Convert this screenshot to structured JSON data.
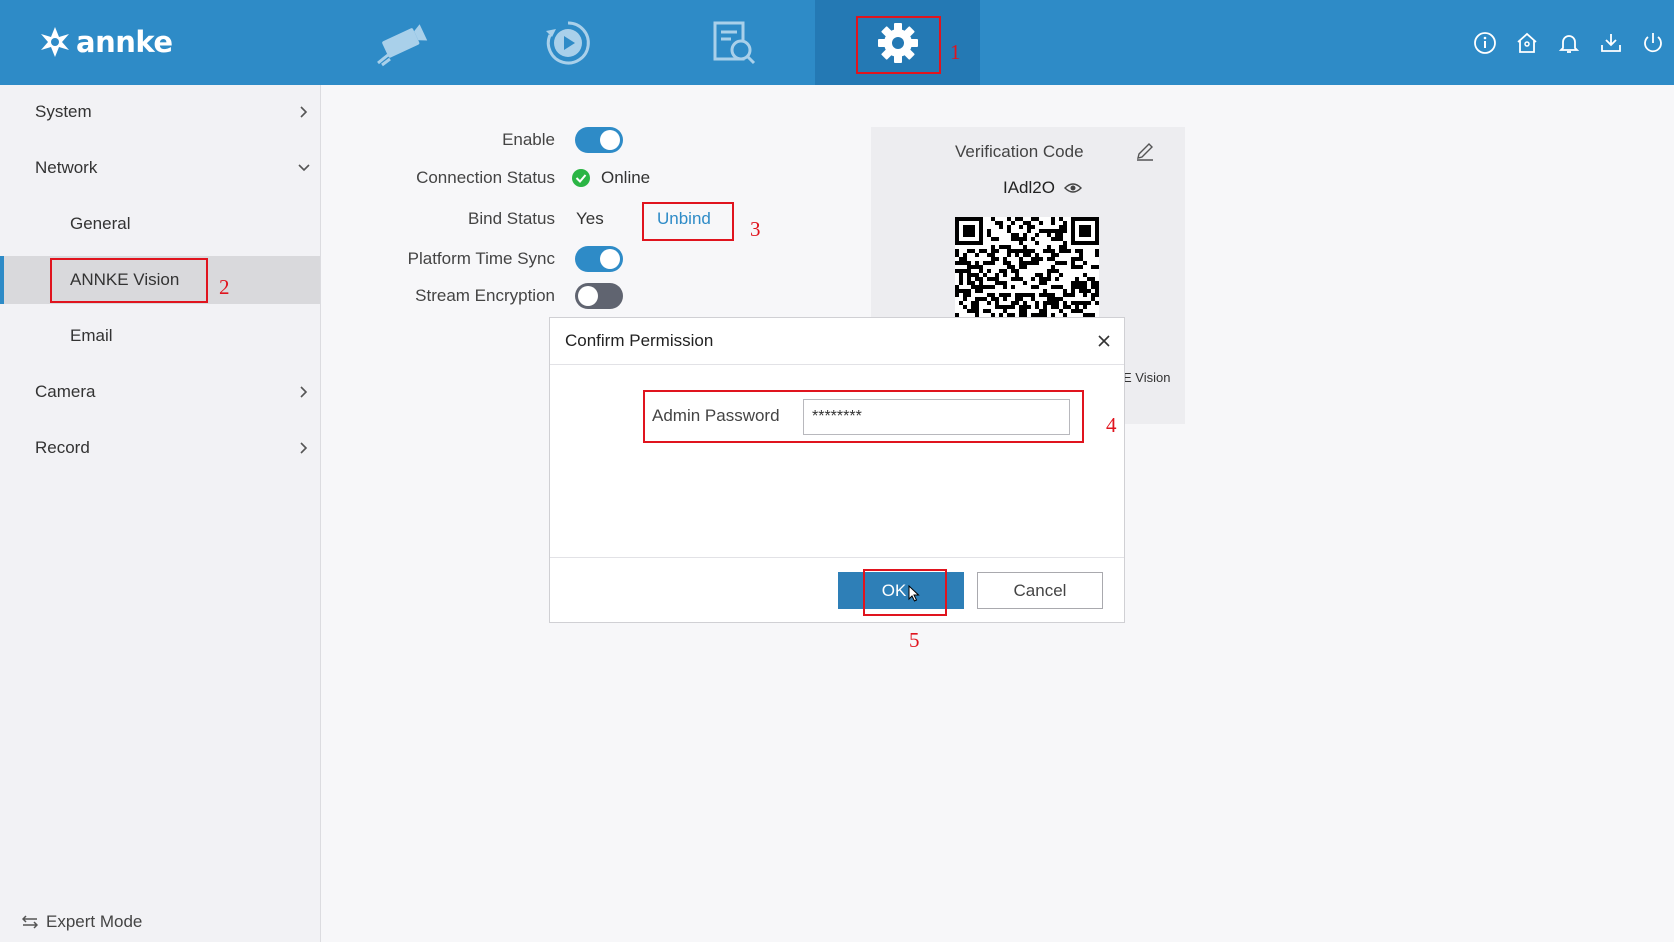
{
  "brand": {
    "logo_text": "annke"
  },
  "top_nav": {
    "tabs": [
      {
        "icon": "camera-icon"
      },
      {
        "icon": "playback-icon"
      },
      {
        "icon": "search-log-icon"
      },
      {
        "icon": "gear-icon",
        "active": true
      }
    ],
    "right_icons": [
      "info-icon",
      "home-icon",
      "bell-icon",
      "download-icon",
      "power-icon"
    ]
  },
  "sidebar": {
    "items": [
      {
        "label": "System"
      },
      {
        "label": "Network"
      },
      {
        "label": "General"
      },
      {
        "label": "ANNKE Vision",
        "selected": true
      },
      {
        "label": "Email"
      },
      {
        "label": "Camera"
      },
      {
        "label": "Record"
      }
    ],
    "expert_mode": "Expert Mode"
  },
  "form": {
    "enable_label": "Enable",
    "enable_on": true,
    "connection_status_label": "Connection Status",
    "connection_status_value": "Online",
    "bind_status_label": "Bind Status",
    "bind_status_value": "Yes",
    "unbind_label": "Unbind",
    "time_sync_label": "Platform Time Sync",
    "time_sync_on": true,
    "stream_encryption_label": "Stream Encryption",
    "stream_encryption_on": false
  },
  "verification": {
    "title": "Verification Code",
    "code": "IAdl2O",
    "partial_text": "E Vision"
  },
  "modal": {
    "title": "Confirm Permission",
    "password_label": "Admin Password",
    "password_value": "********",
    "ok_label": "OK",
    "cancel_label": "Cancel"
  },
  "annotations": [
    "1",
    "2",
    "3",
    "4",
    "5"
  ],
  "colors": {
    "header": "#2e8bc7",
    "accent": "#2e8bc7",
    "annotation": "#e0141e",
    "online": "#2bb545"
  }
}
